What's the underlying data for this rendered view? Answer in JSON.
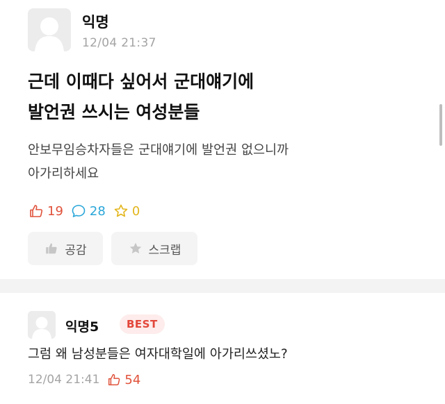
{
  "post": {
    "author": "익명",
    "timestamp": "12/04 21:37",
    "title_line1": "근데 이때다 싶어서 군대얘기에",
    "title_line2": "발언권 쓰시는 여성분들",
    "body_line1": "안보무임승차자들은 군대얘기에 발언권 없으니까",
    "body_line2": "아가리하세요",
    "stats": {
      "likes": "19",
      "comments": "28",
      "scraps": "0"
    },
    "buttons": {
      "like_label": "공감",
      "scrap_label": "스크랩"
    }
  },
  "comment": {
    "author": "익명5",
    "badge": "BEST",
    "text": "그럼 왜 남성분들은 여자대학일에 아가리쓰셨노?",
    "timestamp": "12/04 21:41",
    "likes": "54"
  },
  "colors": {
    "like": "#e0513a",
    "comment": "#29a6d8",
    "scrap": "#e3b61d",
    "badge_bg": "#fdeceb",
    "badge_text": "#e3463a"
  },
  "icons": [
    "thumbs-up-icon",
    "speech-bubble-icon",
    "star-icon",
    "avatar-icon"
  ]
}
